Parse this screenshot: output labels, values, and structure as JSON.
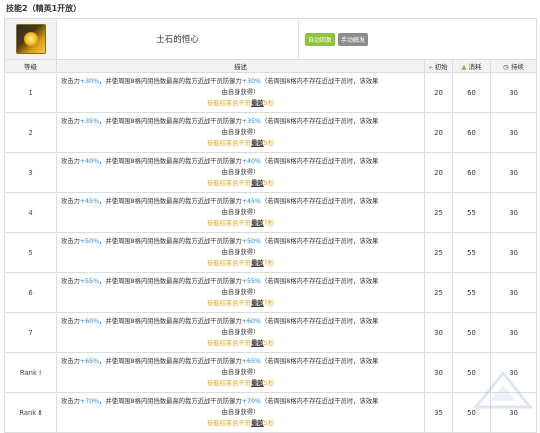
{
  "section_title": "技能2（精英1开放）",
  "skill": {
    "name": "土石的恒心",
    "tags": [
      "自动回复",
      "手动触发"
    ],
    "icon": "skill-icon"
  },
  "columns": {
    "level": "等级",
    "desc": "描述",
    "init": "初始",
    "cost": "消耗",
    "duration": "持续"
  },
  "desc_parts": {
    "p1": "攻击力",
    "p2": "，并使周围8格内阻挡数最高的我方近战干员防御力",
    "p3": "（若周围8格内不存在近战干员时，该效果",
    "line2": "由自身获得）",
    "line3a": "技能结束后干员",
    "stun": "晕眩",
    "line3b": "秒"
  },
  "rows": [
    {
      "level": "1",
      "atk": "+30%",
      "def": "+30%",
      "stun": "9",
      "init": "20",
      "cost": "60",
      "dur": "30"
    },
    {
      "level": "2",
      "atk": "+35%",
      "def": "+35%",
      "stun": "9",
      "init": "20",
      "cost": "60",
      "dur": "30"
    },
    {
      "level": "3",
      "atk": "+40%",
      "def": "+40%",
      "stun": "9",
      "init": "20",
      "cost": "60",
      "dur": "30"
    },
    {
      "level": "4",
      "atk": "+45%",
      "def": "+45%",
      "stun": "7",
      "init": "25",
      "cost": "55",
      "dur": "30"
    },
    {
      "level": "5",
      "atk": "+50%",
      "def": "+50%",
      "stun": "7",
      "init": "25",
      "cost": "55",
      "dur": "30"
    },
    {
      "level": "6",
      "atk": "+55%",
      "def": "+55%",
      "stun": "7",
      "init": "25",
      "cost": "55",
      "dur": "30"
    },
    {
      "level": "7",
      "atk": "+60%",
      "def": "+60%",
      "stun": "5",
      "init": "30",
      "cost": "50",
      "dur": "30"
    },
    {
      "level": "Rank Ⅰ",
      "atk": "+65%",
      "def": "+65%",
      "stun": "5",
      "init": "30",
      "cost": "50",
      "dur": "30"
    },
    {
      "level": "Rank Ⅱ",
      "atk": "+70%",
      "def": "+70%",
      "stun": "5",
      "init": "35",
      "cost": "50",
      "dur": "30"
    }
  ]
}
